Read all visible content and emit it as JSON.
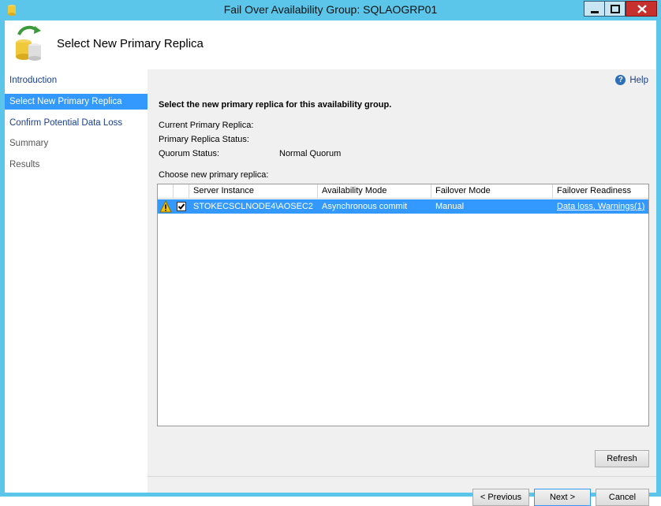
{
  "window": {
    "title": "Fail Over Availability Group: SQLAOGRP01"
  },
  "header": {
    "title": "Select New Primary Replica"
  },
  "sidebar": {
    "items": [
      {
        "label": "Introduction"
      },
      {
        "label": "Select New Primary Replica"
      },
      {
        "label": "Confirm Potential Data Loss"
      },
      {
        "label": "Summary"
      },
      {
        "label": "Results"
      }
    ]
  },
  "main": {
    "help_label": "Help",
    "instruction": "Select the new primary replica for this availability group.",
    "current_primary_label": "Current Primary Replica:",
    "current_primary_value": "",
    "primary_status_label": "Primary Replica Status:",
    "primary_status_value": "",
    "quorum_label": "Quorum Status:",
    "quorum_value": "Normal Quorum",
    "choose_label": "Choose new primary replica:"
  },
  "grid": {
    "columns": [
      "Server Instance",
      "Availability Mode",
      "Failover Mode",
      "Failover Readiness"
    ],
    "rows": [
      {
        "warning_icon": "warning-icon",
        "checked": true,
        "server_instance": "STOKECSCLNODE4\\AOSEC2",
        "availability_mode": "Asynchronous commit",
        "failover_mode": "Manual",
        "failover_readiness": "Data loss, Warnings(1)"
      }
    ]
  },
  "buttons": {
    "refresh": "Refresh",
    "previous": "< Previous",
    "next": "Next >",
    "cancel": "Cancel"
  },
  "colors": {
    "selection": "#3399ff",
    "titlebar": "#5bc6ea",
    "link": "#1b3f8a"
  }
}
